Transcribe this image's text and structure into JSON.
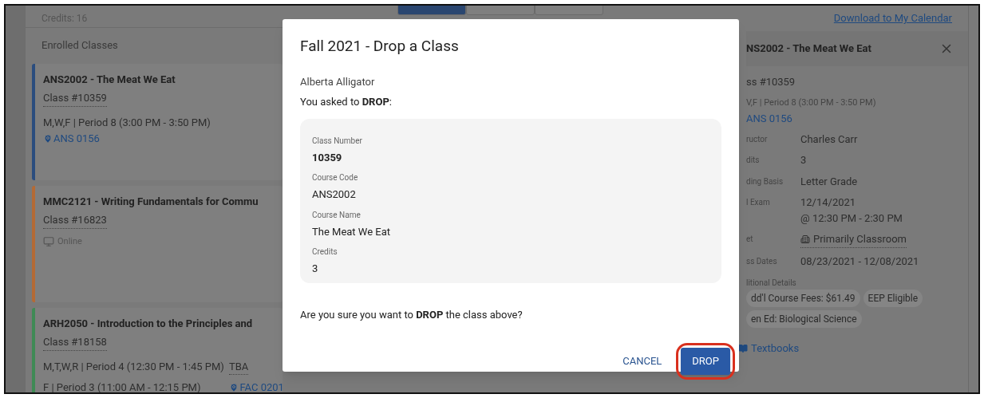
{
  "summary": {
    "credits": "Credits: 16"
  },
  "view_tabs": [
    {
      "selected": true
    },
    {
      "selected": false
    },
    {
      "selected": false
    }
  ],
  "enrolled": {
    "title": "Enrolled Classes",
    "classes": [
      {
        "title": "ANS2002 - The Meat We Eat",
        "class_no": "Class #10359",
        "color": "#2b4d7e",
        "meetings": [
          {
            "kind": "time",
            "text": "M,W,F | Period 8 (3:00 PM - 3:50 PM)"
          }
        ],
        "location": {
          "kind": "room",
          "text": "ANS 0156"
        }
      },
      {
        "title": "MMC2121 - Writing Fundamentals for Commu",
        "class_no": "Class #16823",
        "color": "#b46a35",
        "location": {
          "kind": "online",
          "text": "Online"
        }
      },
      {
        "title": "ARH2050 - Introduction to the Principles and",
        "class_no": "Class #18158",
        "color": "#3f8a55",
        "meetings": [
          {
            "kind": "time",
            "text": "M,T,W,R | Period 4 (12:30 PM - 1:45 PM)",
            "extra": "TBA"
          },
          {
            "kind": "time",
            "text": "F | Period 3 (11:00 AM - 12:15 PM)",
            "room": "FAC 0201"
          }
        ]
      }
    ]
  },
  "detail_panel": {
    "calendar_link": "Download to My Calendar",
    "title": "NS2002 - The Meat We Eat",
    "class_no": "ss #10359",
    "schedule": "V,F | Period 8 (3:00 PM - 3:50 PM)",
    "room": "ANS 0156",
    "fields": [
      {
        "label": "ructor",
        "values": [
          "Charles Carr"
        ]
      },
      {
        "label": "dits",
        "values": [
          "3"
        ]
      },
      {
        "label": "ding Basis",
        "values": [
          "Letter Grade"
        ]
      },
      {
        "label": "l Exam",
        "values": [
          "12/14/2021",
          "@ 12:30 PM - 2:30 PM"
        ]
      },
      {
        "label": "et",
        "values": [
          "Primarily Classroom"
        ],
        "kind": "building"
      },
      {
        "label": "ss Dates",
        "values": [
          "08/23/2021 - 12/08/2021"
        ]
      }
    ],
    "details_label": "litional Details",
    "chips": [
      "dd'l Course Fees: $61.49",
      "EEP Eligible",
      "en Ed: Biological Science"
    ],
    "textbooks": "Textbooks"
  },
  "dialog": {
    "title": "Fall 2021 - Drop a Class",
    "student": "Alberta Alligator",
    "prompt": "You asked to **DROP**:",
    "fields": [
      {
        "label": "Class Number",
        "value": "10359",
        "bold": true
      },
      {
        "label": "Course Code",
        "value": "ANS2002",
        "bold": false
      },
      {
        "label": "Course Name",
        "value": "The Meat We Eat",
        "bold": false
      },
      {
        "label": "Credits",
        "value": "3",
        "bold": false
      }
    ],
    "question": "Are you sure you want to **DROP** the class above?",
    "cancel": "CANCEL",
    "confirm": "DROP",
    "confirm_highlighted": true
  }
}
